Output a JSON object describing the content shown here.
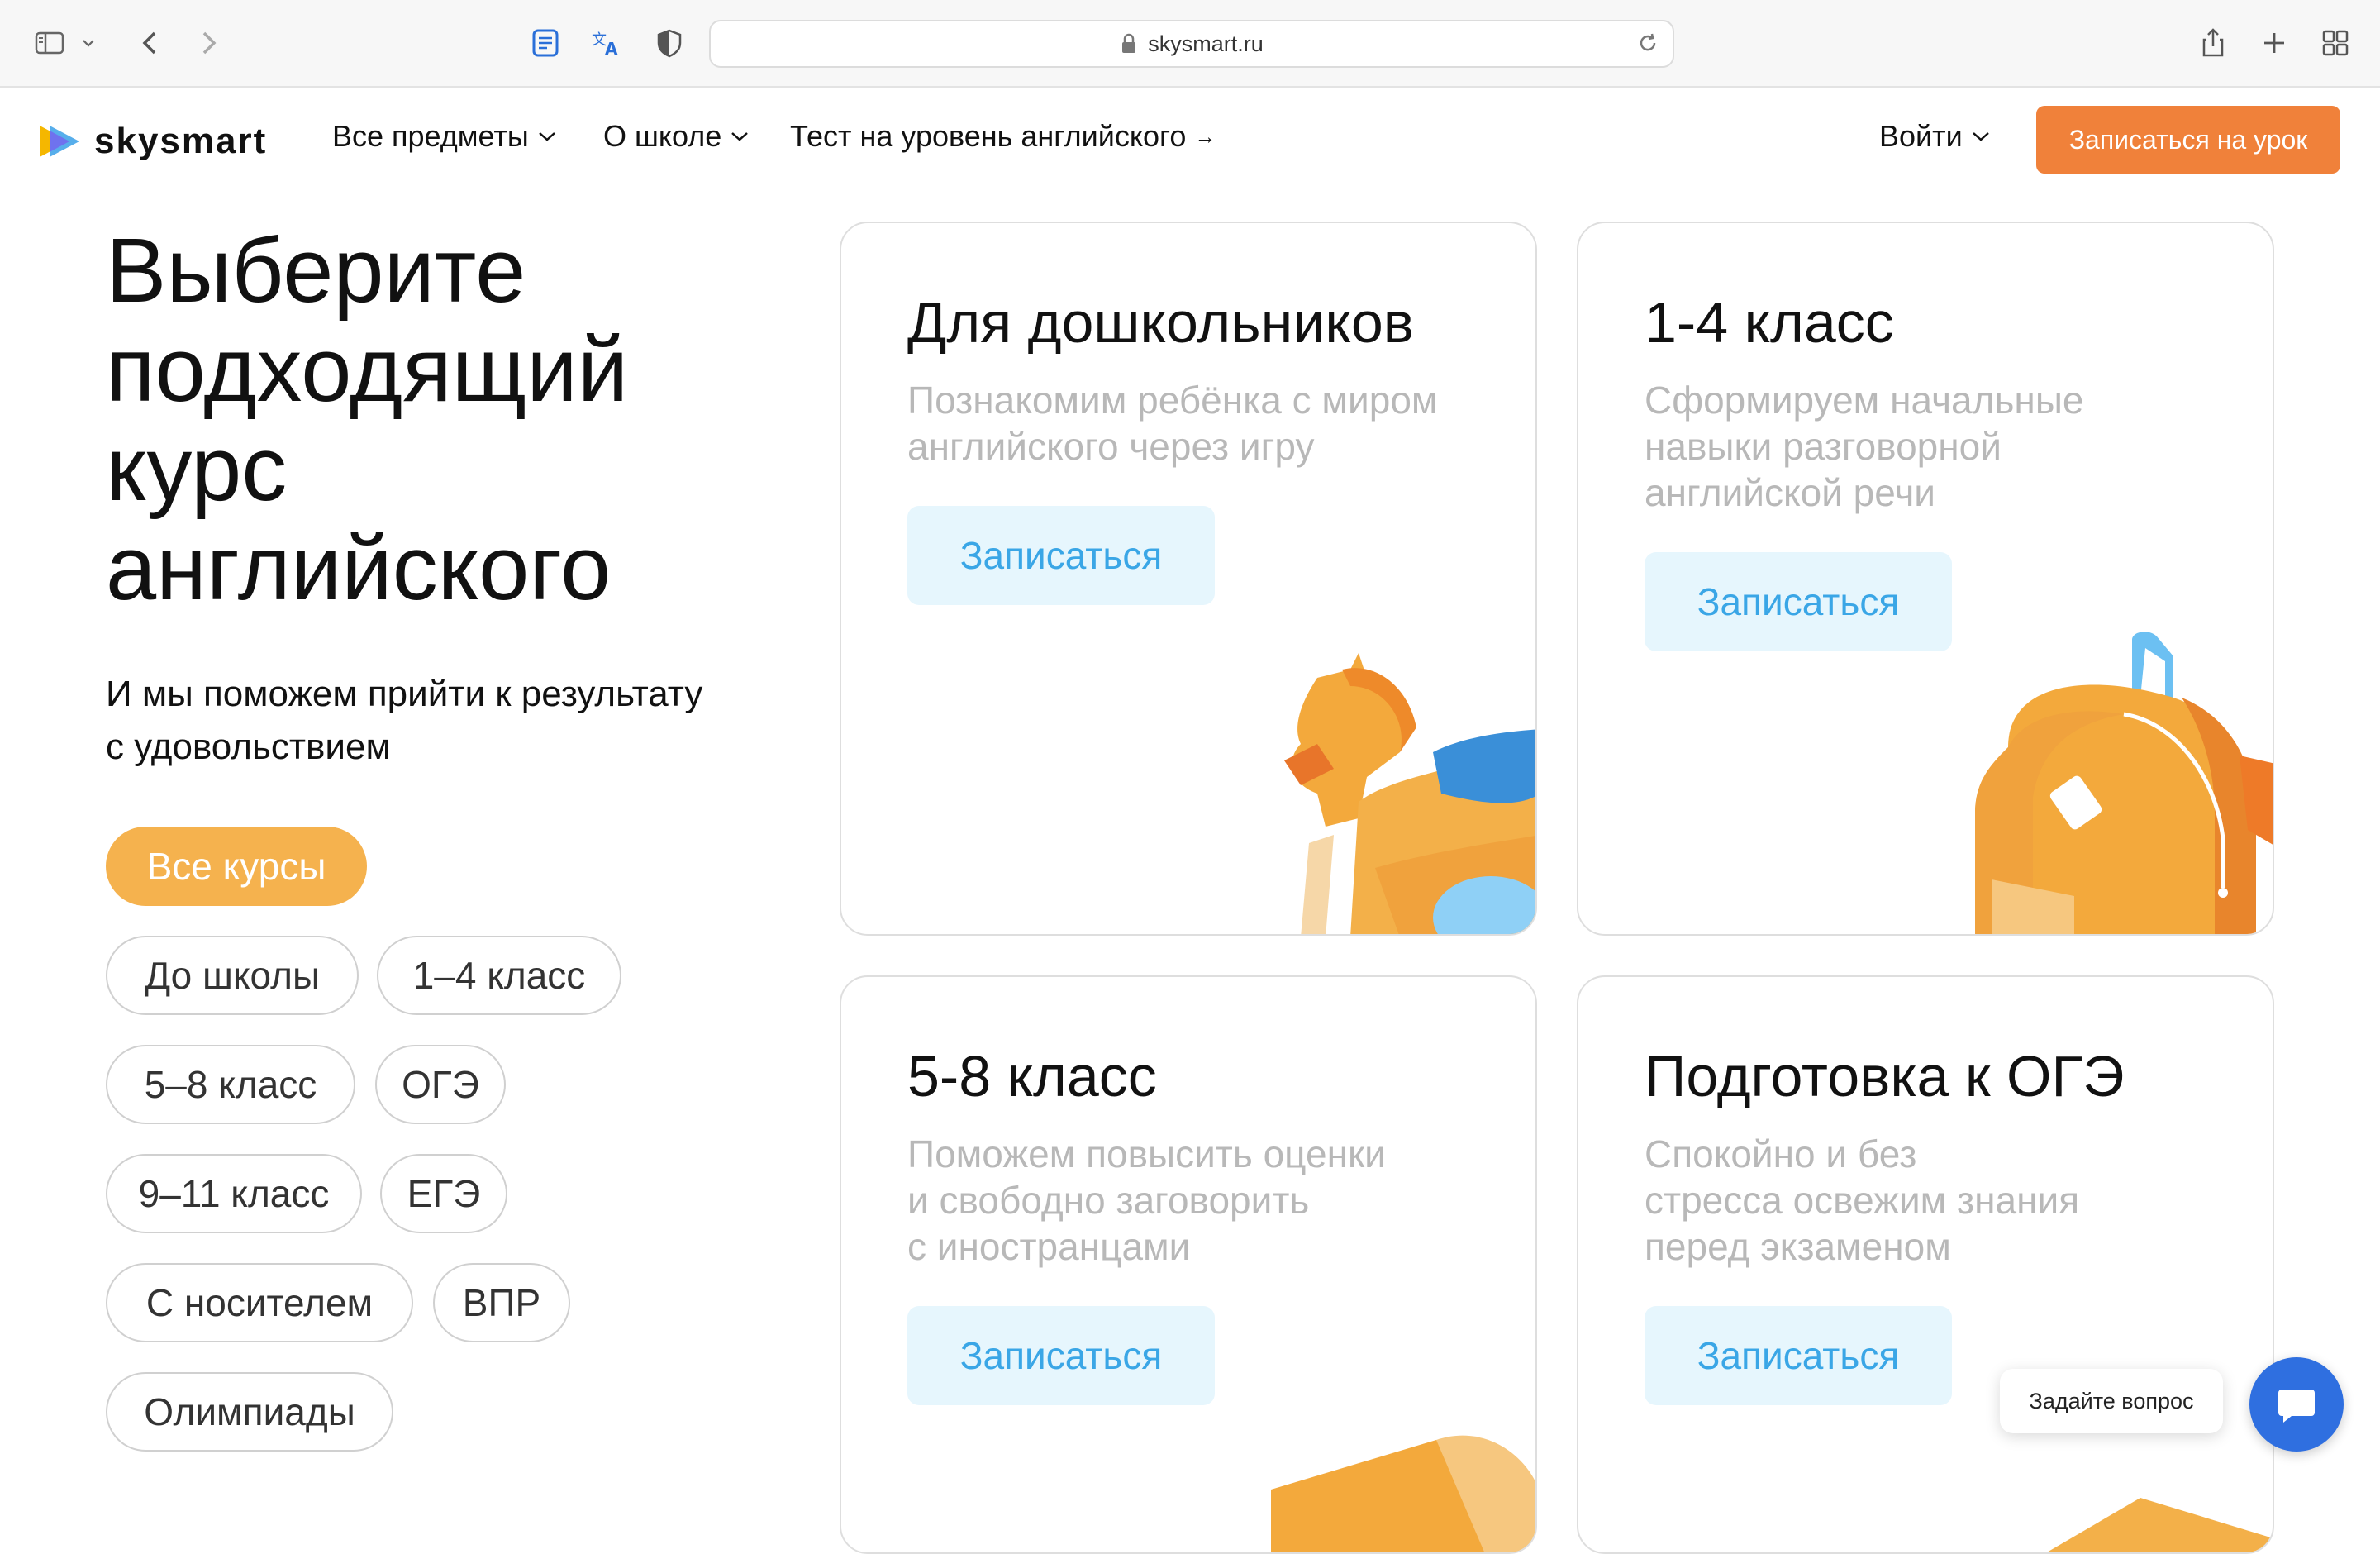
{
  "browser": {
    "url": "skysmart.ru",
    "icons": [
      "sidebar-icon",
      "chevron-down-icon",
      "back-icon",
      "forward-icon",
      "reader-icon",
      "translate-icon",
      "privacy-shield-icon",
      "lock-icon",
      "reload-icon",
      "share-icon",
      "new-tab-icon",
      "tab-overview-icon"
    ]
  },
  "header": {
    "logo_text": "skysmart",
    "nav": {
      "subjects": "Все предметы",
      "about": "О школе",
      "test": "Тест на уровень английского"
    },
    "login": "Войти",
    "cta": "Записаться на урок"
  },
  "hero": {
    "title_lines": [
      "Выберите",
      "подходящий",
      "курс",
      "английского"
    ],
    "subtitle_lines": [
      "И мы поможем прийти к результату",
      "с удовольствием"
    ]
  },
  "filters": [
    {
      "label": "Все курсы",
      "active": true
    },
    {
      "label": "До школы",
      "active": false
    },
    {
      "label": "1–4 класс",
      "active": false
    },
    {
      "label": "5–8 класс",
      "active": false
    },
    {
      "label": "ОГЭ",
      "active": false
    },
    {
      "label": "9–11 класс",
      "active": false
    },
    {
      "label": "ЕГЭ",
      "active": false
    },
    {
      "label": "С носителем",
      "active": false
    },
    {
      "label": "ВПР",
      "active": false
    },
    {
      "label": "Олимпиады",
      "active": false
    }
  ],
  "cards": [
    {
      "title": "Для дошкольников",
      "desc": [
        "Познакомим ребёнка с миром",
        "английского через игру"
      ],
      "button": "Записаться",
      "art": "rocking-horse-icon"
    },
    {
      "title": "1-4 класс",
      "desc": [
        "Сформируем начальные",
        "навыки разговорной",
        "английской речи"
      ],
      "button": "Записаться",
      "art": "backpack-icon"
    },
    {
      "title": "5-8 класс",
      "desc": [
        "Поможем повысить оценки",
        "и свободно заговорить",
        "с иностранцами"
      ],
      "button": "Записаться",
      "art": "book-icon"
    },
    {
      "title": "Подготовка к ОГЭ",
      "desc": [
        "Спокойно и без",
        "стресса освежим знания",
        "перед экзаменом"
      ],
      "button": "Записаться",
      "art": "book-icon"
    }
  ],
  "chat": {
    "bubble": "Задайте вопрос",
    "icon": "chat-icon"
  },
  "colors": {
    "cta": "#f0813a",
    "chip_active": "#f5b24e",
    "card_button_bg": "#e6f6fd",
    "card_button_text": "#3aa6e6",
    "chat_button": "#2f6fe0"
  }
}
